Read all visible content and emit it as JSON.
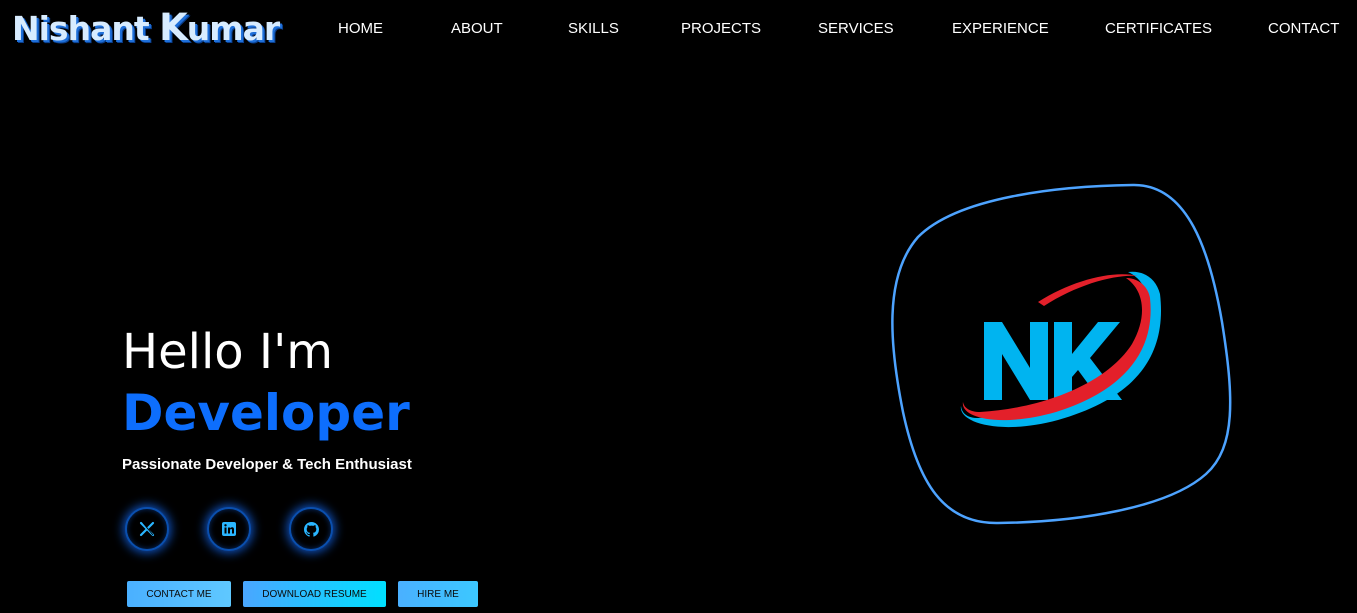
{
  "brand": {
    "first": "Nishant ",
    "k": "K",
    "rest": "umar"
  },
  "nav": {
    "items": [
      {
        "label": "HOME"
      },
      {
        "label": "ABOUT"
      },
      {
        "label": "SKILLS"
      },
      {
        "label": "PROJECTS"
      },
      {
        "label": "SERVICES"
      },
      {
        "label": "EXPERIENCE"
      },
      {
        "label": "CERTIFICATES"
      },
      {
        "label": "CONTACT"
      }
    ]
  },
  "hero": {
    "greeting": "Hello I'm",
    "role": "Developer",
    "tagline": "Passionate Developer & Tech Enthusiast"
  },
  "social": [
    {
      "icon": "x-twitter-icon"
    },
    {
      "icon": "linkedin-icon"
    },
    {
      "icon": "github-icon"
    }
  ],
  "buttons": {
    "contact": "CONTACT ME",
    "resume": "DOWNLOAD RESUME",
    "hire": "HIRE ME"
  },
  "logo": {
    "text": "NK"
  },
  "colors": {
    "background": "#000000",
    "accent": "#0d6efd",
    "blob_border": "#4da3ff",
    "logo_cyan": "#00b4f0",
    "logo_red": "#e3202a"
  }
}
